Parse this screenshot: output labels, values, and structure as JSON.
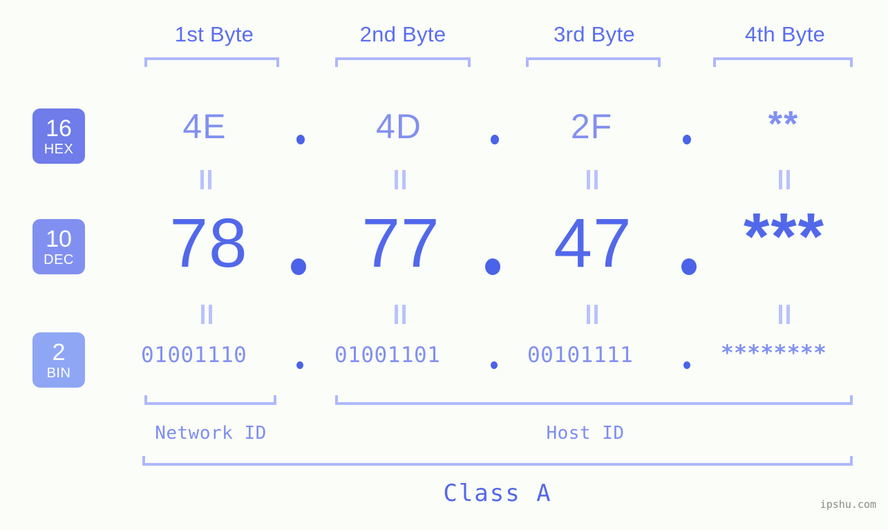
{
  "watermark": "ipshu.com",
  "byte_headers": [
    {
      "label": "1st Byte"
    },
    {
      "label": "2nd Byte"
    },
    {
      "label": "3rd Byte"
    },
    {
      "label": "4th Byte"
    }
  ],
  "bases": [
    {
      "number": "16",
      "name": "HEX",
      "color": "#6f7ce9"
    },
    {
      "number": "10",
      "name": "DEC",
      "color": "#8190f0"
    },
    {
      "number": "2",
      "name": "BIN",
      "color": "#8fa6f5"
    }
  ],
  "rows": {
    "hex": {
      "base_number": "16",
      "base_name": "HEX",
      "values": [
        "4E",
        "4D",
        "2F",
        "**"
      ],
      "separator": "."
    },
    "dec": {
      "base_number": "10",
      "base_name": "DEC",
      "values": [
        "78",
        "77",
        "47",
        "***"
      ],
      "separator": "."
    },
    "bin": {
      "base_number": "2",
      "base_name": "BIN",
      "values": [
        "01001110",
        "01001101",
        "00101111",
        "********"
      ],
      "separator": "."
    }
  },
  "equals_symbol": "=",
  "sections": [
    {
      "label": "Network ID"
    },
    {
      "label": "Host ID"
    }
  ],
  "class": {
    "label": "Class A"
  },
  "colors": {
    "background": "#fbfdf8",
    "bracket": "#aeb8fb",
    "header_text": "#5b6ef0",
    "hex_text": "#8190f0",
    "dec_text": "#5268ea",
    "bin_text": "#8190f0",
    "dot": "#4a63e8",
    "equals": "#b9c2fb",
    "section_text": "#7d8df0",
    "class_text": "#5268ea",
    "watermark_text": "#8a8a8a"
  }
}
